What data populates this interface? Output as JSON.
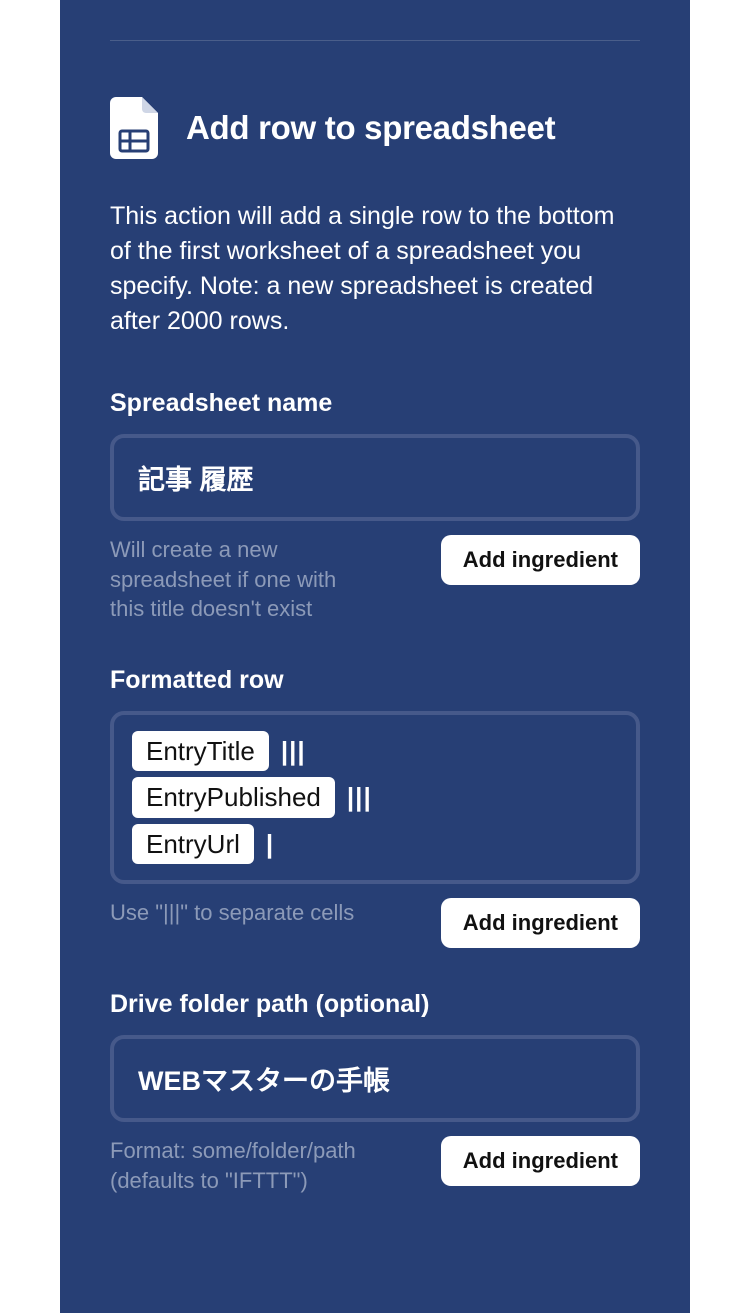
{
  "header": {
    "title": "Add row to spreadsheet"
  },
  "description": "This action will add a single row to the bottom of the first worksheet of a spreadsheet you specify. Note: a new spreadsheet is created after 2000 rows.",
  "fields": {
    "spreadsheet_name": {
      "label": "Spreadsheet name",
      "value": "記事 履歴",
      "hint": "Will create a new spreadsheet if one with this title doesn't exist",
      "button": "Add ingredient"
    },
    "formatted_row": {
      "label": "Formatted row",
      "tokens": [
        "EntryTitle",
        "EntryPublished",
        "EntryUrl"
      ],
      "separators": [
        "|||",
        "|||",
        "|"
      ],
      "hint": "Use \"|||\" to separate cells",
      "button": "Add ingredient"
    },
    "drive_folder_path": {
      "label": "Drive folder path (optional)",
      "value": "WEBマスターの手帳",
      "hint": "Format: some/folder/path (defaults to \"IFTTT\")",
      "button": "Add ingredient"
    }
  }
}
